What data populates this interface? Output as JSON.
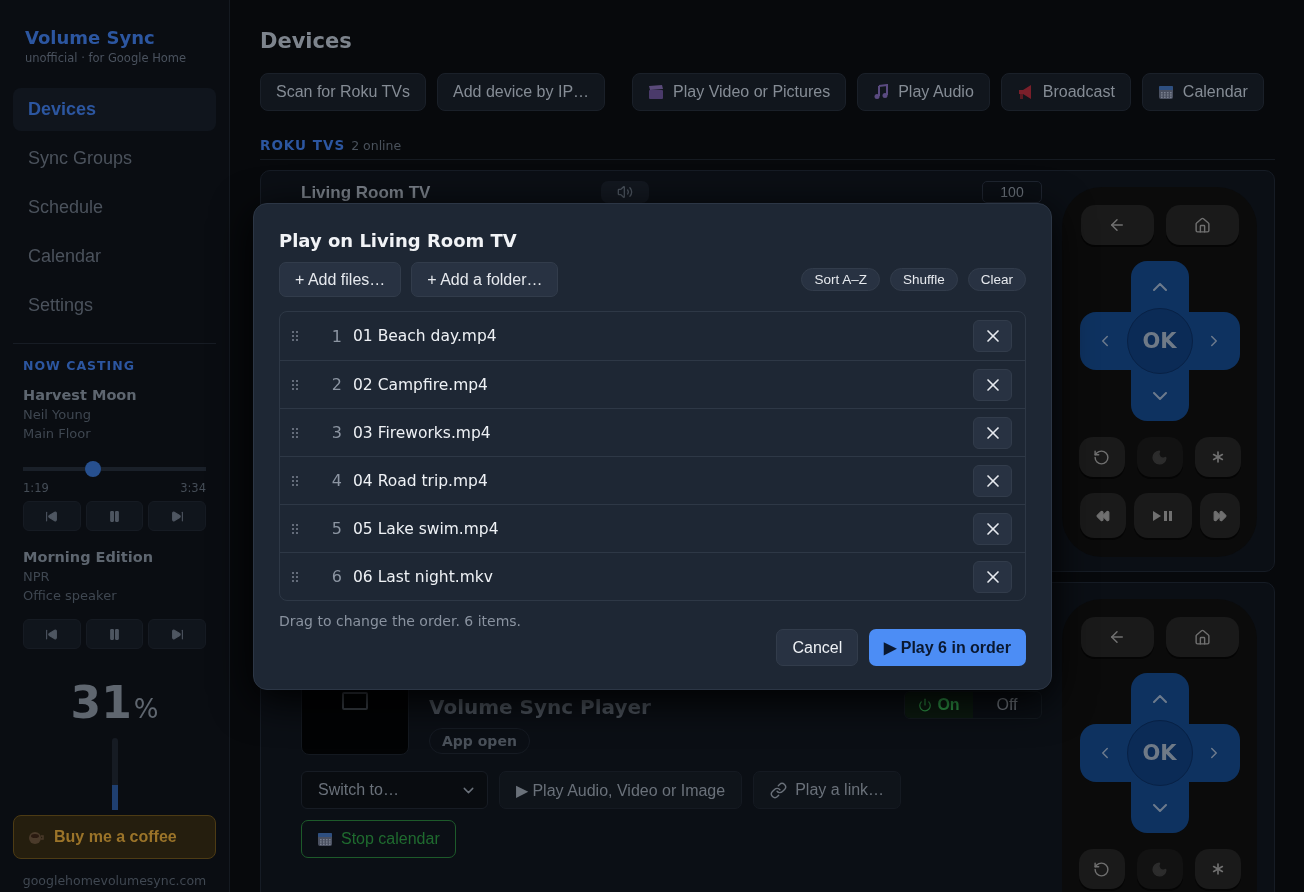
{
  "sidebar": {
    "brand": "Volume Sync",
    "tagline": "unofficial · for Google Home",
    "nav": [
      {
        "label": "Devices",
        "selected": true
      },
      {
        "label": "Sync Groups",
        "selected": false
      },
      {
        "label": "Schedule",
        "selected": false
      },
      {
        "label": "Calendar",
        "selected": false
      },
      {
        "label": "Settings",
        "selected": false
      }
    ],
    "now_casting": {
      "heading": "NOW CASTING",
      "sessions": [
        {
          "title": "Harvest Moon",
          "artist": "Neil Young",
          "device": "Main Floor",
          "progress": {
            "level": 0.38,
            "elapsed": "1:19",
            "duration": "3:34"
          }
        },
        {
          "title": "Morning Edition",
          "artist": "NPR",
          "device": "Office speaker"
        }
      ]
    },
    "volume": {
      "value": "31",
      "unit": "%",
      "level": 0.35
    },
    "coffee_button": "Buy me a coffee",
    "website": "googlehomevolumesync.com"
  },
  "main": {
    "title": "Devices",
    "device_actions": [
      "Scan for Roku TVs",
      "Add device by IP…"
    ],
    "media_actions": [
      {
        "kind": "video",
        "label": "Play Video or Pictures"
      },
      {
        "kind": "audio",
        "label": "Play Audio"
      },
      {
        "kind": "broadcast",
        "label": "Broadcast"
      },
      {
        "kind": "calendar",
        "label": "Calendar"
      }
    ],
    "section": {
      "title": "ROKU TVS",
      "count": "2 online"
    },
    "devices": [
      {
        "name": "Living Room TV",
        "volume_reading": "100",
        "remote": {
          "ok": "OK"
        }
      },
      {
        "app": "Volume Sync Player",
        "status": "App open",
        "power": [
          {
            "label": "On",
            "selected": true
          },
          {
            "label": "Off",
            "selected": false
          }
        ],
        "switch_placeholder": "Switch to…",
        "actions": [
          {
            "kind": "play",
            "label": "▶ Play Audio, Video or Image"
          },
          {
            "kind": "link",
            "label": "Play a link…"
          }
        ],
        "calendar_button": "Stop calendar",
        "remote": {
          "ok": "OK"
        }
      }
    ]
  },
  "dialog": {
    "title": "Play on Living Room TV",
    "add_buttons": [
      "+ Add files…",
      "+ Add a folder…"
    ],
    "tools": [
      "Sort A–Z",
      "Shuffle",
      "Clear"
    ],
    "items": [
      {
        "number": "1",
        "name": "01 Beach day.mp4"
      },
      {
        "number": "2",
        "name": "02 Campfire.mp4"
      },
      {
        "number": "3",
        "name": "03 Fireworks.mp4"
      },
      {
        "number": "4",
        "name": "04 Road trip.mp4"
      },
      {
        "number": "5",
        "name": "05 Lake swim.mp4"
      },
      {
        "number": "6",
        "name": "06 Last night.mkv"
      }
    ],
    "hint": "Drag to change the order. 6 items.",
    "cancel": "Cancel",
    "play": "▶ Play 6 in order"
  }
}
